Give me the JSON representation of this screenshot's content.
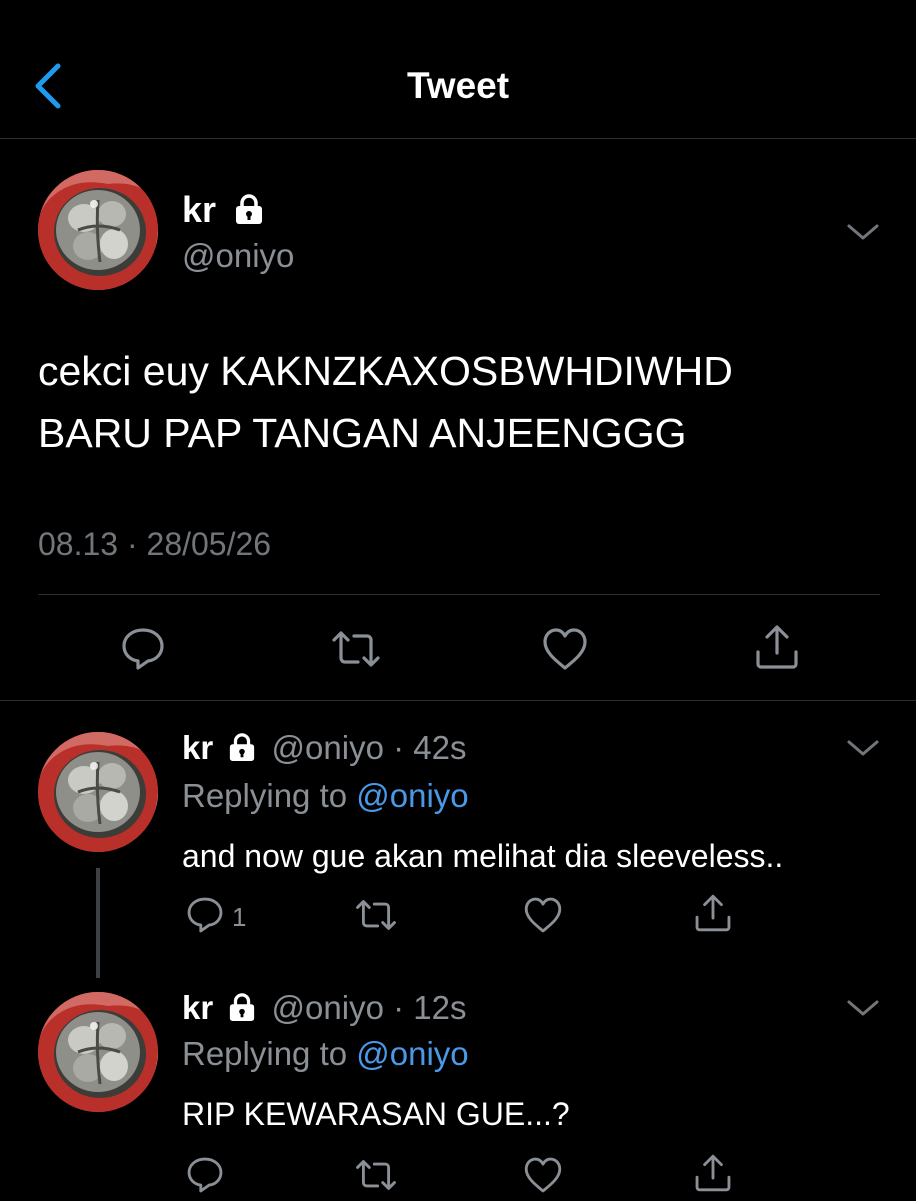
{
  "header": {
    "title": "Tweet"
  },
  "main_tweet": {
    "name": "kr",
    "handle": "@oniyo",
    "text_line1": "cekci euy KAKNZKAXOSBWHDIWHD",
    "text_line2": "BARU PAP TANGAN ANJEENGGG",
    "timestamp": "08.13 · 28/05/26"
  },
  "replies": [
    {
      "name": "kr",
      "handle": "@oniyo",
      "time": "· 42s",
      "replying_prefix": "Replying to ",
      "replying_to": "@oniyo",
      "text": "and now gue akan melihat dia sleeveless..",
      "reply_count": "1"
    },
    {
      "name": "kr",
      "handle": "@oniyo",
      "time": "· 12s",
      "replying_prefix": "Replying to ",
      "replying_to": "@oniyo",
      "text": "RIP KEWARASAN GUE...?",
      "reply_count": ""
    }
  ],
  "colors": {
    "background": "#000000",
    "accent": "#1d9bf0",
    "mention": "#4a99e9",
    "secondary_text": "#8b9096"
  },
  "icons": {
    "back": "chevron-left-icon",
    "lock": "lock-icon",
    "more": "chevron-down-icon",
    "reply": "comment-icon",
    "retweet": "retweet-icon",
    "like": "heart-icon",
    "share": "share-icon"
  }
}
